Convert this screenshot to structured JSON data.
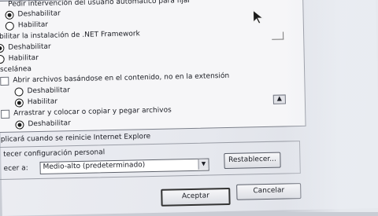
{
  "list": {
    "top_item": "Pedir intervención del usuario automático para fijar",
    "dnet_header": "bilitar la instalación de .NET Framework",
    "misc_header": "scelánea",
    "open_files_label": "Abrir archivos basándose en el contenido, no en la extensión",
    "drag_label": "Arrastrar y colocar o copiar y pegar archivos",
    "opt_disable": "Deshabilitar",
    "opt_enable": "Habilitar"
  },
  "footer_note": "plicará cuando se reinicie Internet Explore",
  "reset_section": {
    "label": "tecer configuración personal",
    "reset_to_label": "ecer a:",
    "combo_value": "Medio-alto (predeterminado)",
    "reset_button": "Restablecer..."
  },
  "buttons": {
    "ok": "Aceptar",
    "cancel": "Cancelar"
  },
  "icons": {
    "scroll_up": "▲",
    "combo_arrow": "▼",
    "cursor": "mouse-pointer-icon"
  }
}
